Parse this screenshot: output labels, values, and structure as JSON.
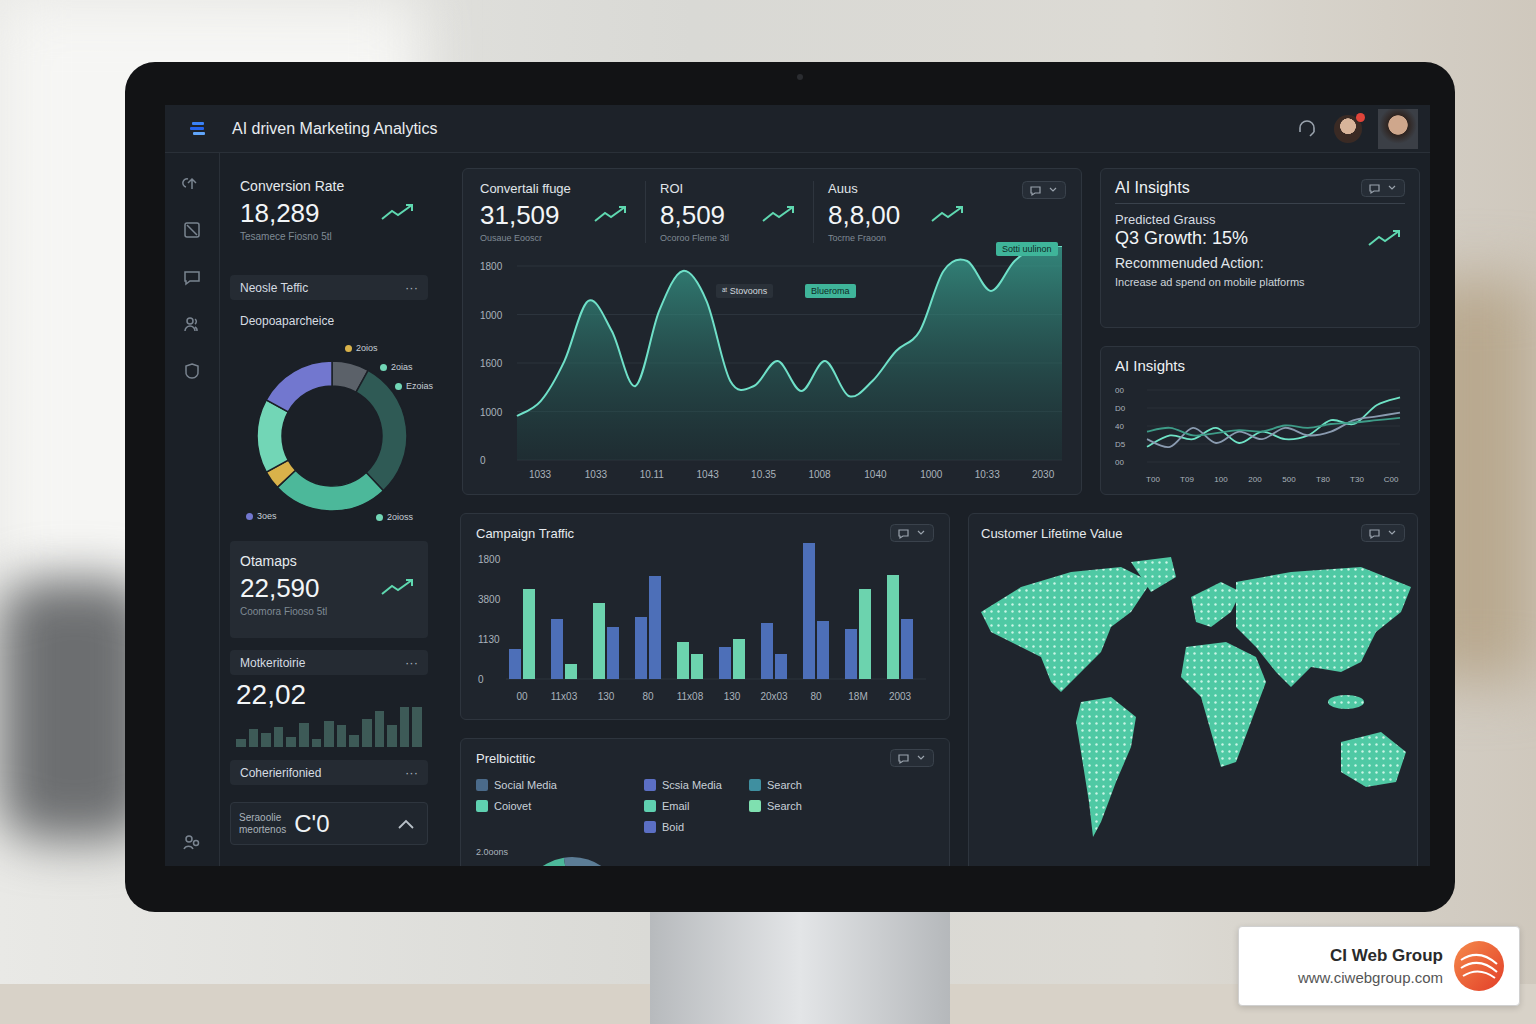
{
  "header": {
    "title": "AI driven Marketing Analytics",
    "notification": true
  },
  "left": {
    "conversion": {
      "title": "Conversion Rate",
      "value": "18,289",
      "sub": "Tesamece Fiosno 5tl"
    },
    "section_traffic": {
      "label": "Neosle Teffic",
      "more": "···"
    },
    "donut": {
      "title": "Deopoaparcheice",
      "segments": [
        {
          "value": 8,
          "color": "#5b6169"
        },
        {
          "value": 30,
          "color": "#2f5a55"
        },
        {
          "value": 25,
          "color": "#4cb89a"
        },
        {
          "value": 4,
          "color": "#d9b24a"
        },
        {
          "value": 16,
          "color": "#72d6b6"
        },
        {
          "value": 17,
          "color": "#7277cf"
        }
      ],
      "labels": [
        {
          "text": "2oios",
          "color": "#d9b24a"
        },
        {
          "text": "2oias",
          "color": "#72d6b6"
        },
        {
          "text": "Ezoias",
          "color": "#72d6b6"
        },
        {
          "text": "3oes",
          "color": "#7277cf"
        },
        {
          "text": "2oioss",
          "color": "#72d6b6"
        }
      ]
    },
    "otamaps": {
      "title": "Otamaps",
      "value": "22,590",
      "sub": "Coomora Fiooso 5tl"
    },
    "section_market": {
      "label": "Motkeritoirie",
      "more": "···"
    },
    "mini": {
      "value": "22,02",
      "bars": [
        8,
        18,
        14,
        20,
        10,
        24,
        8,
        26,
        22,
        12,
        28,
        36,
        22,
        40,
        48
      ]
    },
    "section_cohort": {
      "label": "Coherierifonied",
      "more": "···"
    },
    "bottom": {
      "lines": [
        "Seraoolie",
        "meortenos"
      ],
      "value": "C'0"
    }
  },
  "kpis": [
    {
      "label": "Convertali ffuge",
      "value": "31,509",
      "sub": "Ousaue Eooscr"
    },
    {
      "label": "ROI",
      "value": "8,509",
      "sub": "Ocoroo Fleme 3tl"
    },
    {
      "label": "Auus",
      "value": "8,8,00",
      "sub": "Tocrne Fraoon"
    }
  ],
  "main_chart": {
    "y_ticks": [
      "1800",
      "1000",
      "1600",
      "1000",
      "0"
    ],
    "x_ticks": [
      "1033",
      "1033",
      "10.11",
      "1043",
      "10.35",
      "1008",
      "1040",
      "1000",
      "10:33",
      "2030"
    ],
    "values": [
      408,
      547,
      918,
      1475,
      1197,
      687,
      1383,
      1754,
      1475,
      733,
      687,
      918,
      640,
      918,
      594,
      733,
      1011,
      1197,
      1754,
      1846,
      1568,
      1846,
      1985,
      1985
    ],
    "tags": [
      {
        "text": "ᵃᵗ Stovoons",
        "kind": "dark"
      },
      {
        "text": "Blueroma",
        "kind": "teal"
      },
      {
        "text": "Sotti uulinon",
        "kind": "teal"
      }
    ]
  },
  "insights": {
    "title": "AI Insights",
    "predicted": "Predicted Grauss",
    "growth": "Q3 Growth: 15%",
    "action_label": "Recommenuded Action:",
    "action": "Increase ad spend on mobile platforms"
  },
  "insights_chart": {
    "title": "AI Insights",
    "y_ticks": [
      "00",
      "D0",
      "40",
      "D5",
      "00"
    ],
    "x_ticks": [
      "T00",
      "T09",
      "100",
      "200",
      "500",
      "T80",
      "T30",
      "C00"
    ],
    "series": [
      {
        "values": [
          20,
          35,
          30,
          45,
          25,
          40,
          30,
          35,
          55,
          50,
          75,
          85
        ],
        "color": "#6fe3c6"
      },
      {
        "values": [
          30,
          20,
          45,
          25,
          40,
          30,
          45,
          35,
          40,
          55,
          60,
          65
        ],
        "color": "#8a9bb0"
      },
      {
        "values": [
          40,
          45,
          35,
          38,
          42,
          40,
          48,
          45,
          50,
          52,
          55,
          58
        ],
        "color": "#3e9c88"
      }
    ]
  },
  "campaign": {
    "title": "Campaign Traffic",
    "y_ticks": [
      "1800",
      "3800",
      "1130",
      "0"
    ],
    "x_ticks": [
      "00",
      "11x03",
      "130",
      "80",
      "11x08",
      "130",
      "20x03",
      "80",
      "18M",
      "2003"
    ],
    "bars": [
      {
        "value": 450,
        "color": "#4d6fb8"
      },
      {
        "value": 1350,
        "color": "#6cd3ae"
      },
      {
        "value": 900,
        "color": "#4d6fb8"
      },
      {
        "value": 225,
        "color": "#6cd3ae"
      },
      {
        "value": 1140,
        "color": "#6cd3ae"
      },
      {
        "value": 780,
        "color": "#4d6fb8"
      },
      {
        "value": 930,
        "color": "#4d6fb8"
      },
      {
        "value": 1545,
        "color": "#4d6fb8"
      },
      {
        "value": 555,
        "color": "#6cd3ae"
      },
      {
        "value": 375,
        "color": "#6cd3ae"
      },
      {
        "value": 480,
        "color": "#4d6fb8"
      },
      {
        "value": 600,
        "color": "#6cd3ae"
      },
      {
        "value": 840,
        "color": "#4d6fb8"
      },
      {
        "value": 375,
        "color": "#4d6fb8"
      },
      {
        "value": 2040,
        "color": "#4d6fb8"
      },
      {
        "value": 870,
        "color": "#4d6fb8"
      },
      {
        "value": 750,
        "color": "#4d6fb8"
      },
      {
        "value": 1350,
        "color": "#6cd3ae"
      },
      {
        "value": 1560,
        "color": "#6cd3ae"
      },
      {
        "value": 900,
        "color": "#4d6fb8"
      }
    ]
  },
  "clv": {
    "title": "Customer Lifetime Value"
  },
  "prediction": {
    "title": "Prelbictitic",
    "legend": [
      {
        "label": "Social Media",
        "color": "#4a6a8a"
      },
      {
        "label": "Scsia Media",
        "color": "#5b6fc4"
      },
      {
        "label": "Search",
        "color": "#3f8fa0"
      },
      {
        "label": "Coiovet",
        "color": "#5fd0b0"
      },
      {
        "label": "Email",
        "color": "#5fd0b0"
      },
      {
        "label": "Search",
        "color": "#7fe0b0"
      },
      {
        "label": "Boid",
        "color": "#5b6fc4"
      }
    ],
    "arc_label": "2.0oons",
    "arc": [
      {
        "value": 45,
        "color": "#4cb89a"
      },
      {
        "value": 30,
        "color": "#5c7d96"
      },
      {
        "value": 25,
        "color": "#d9c25a"
      }
    ]
  },
  "badge": {
    "name": "CI Web Group",
    "url": "www.ciwebgroup.com"
  }
}
